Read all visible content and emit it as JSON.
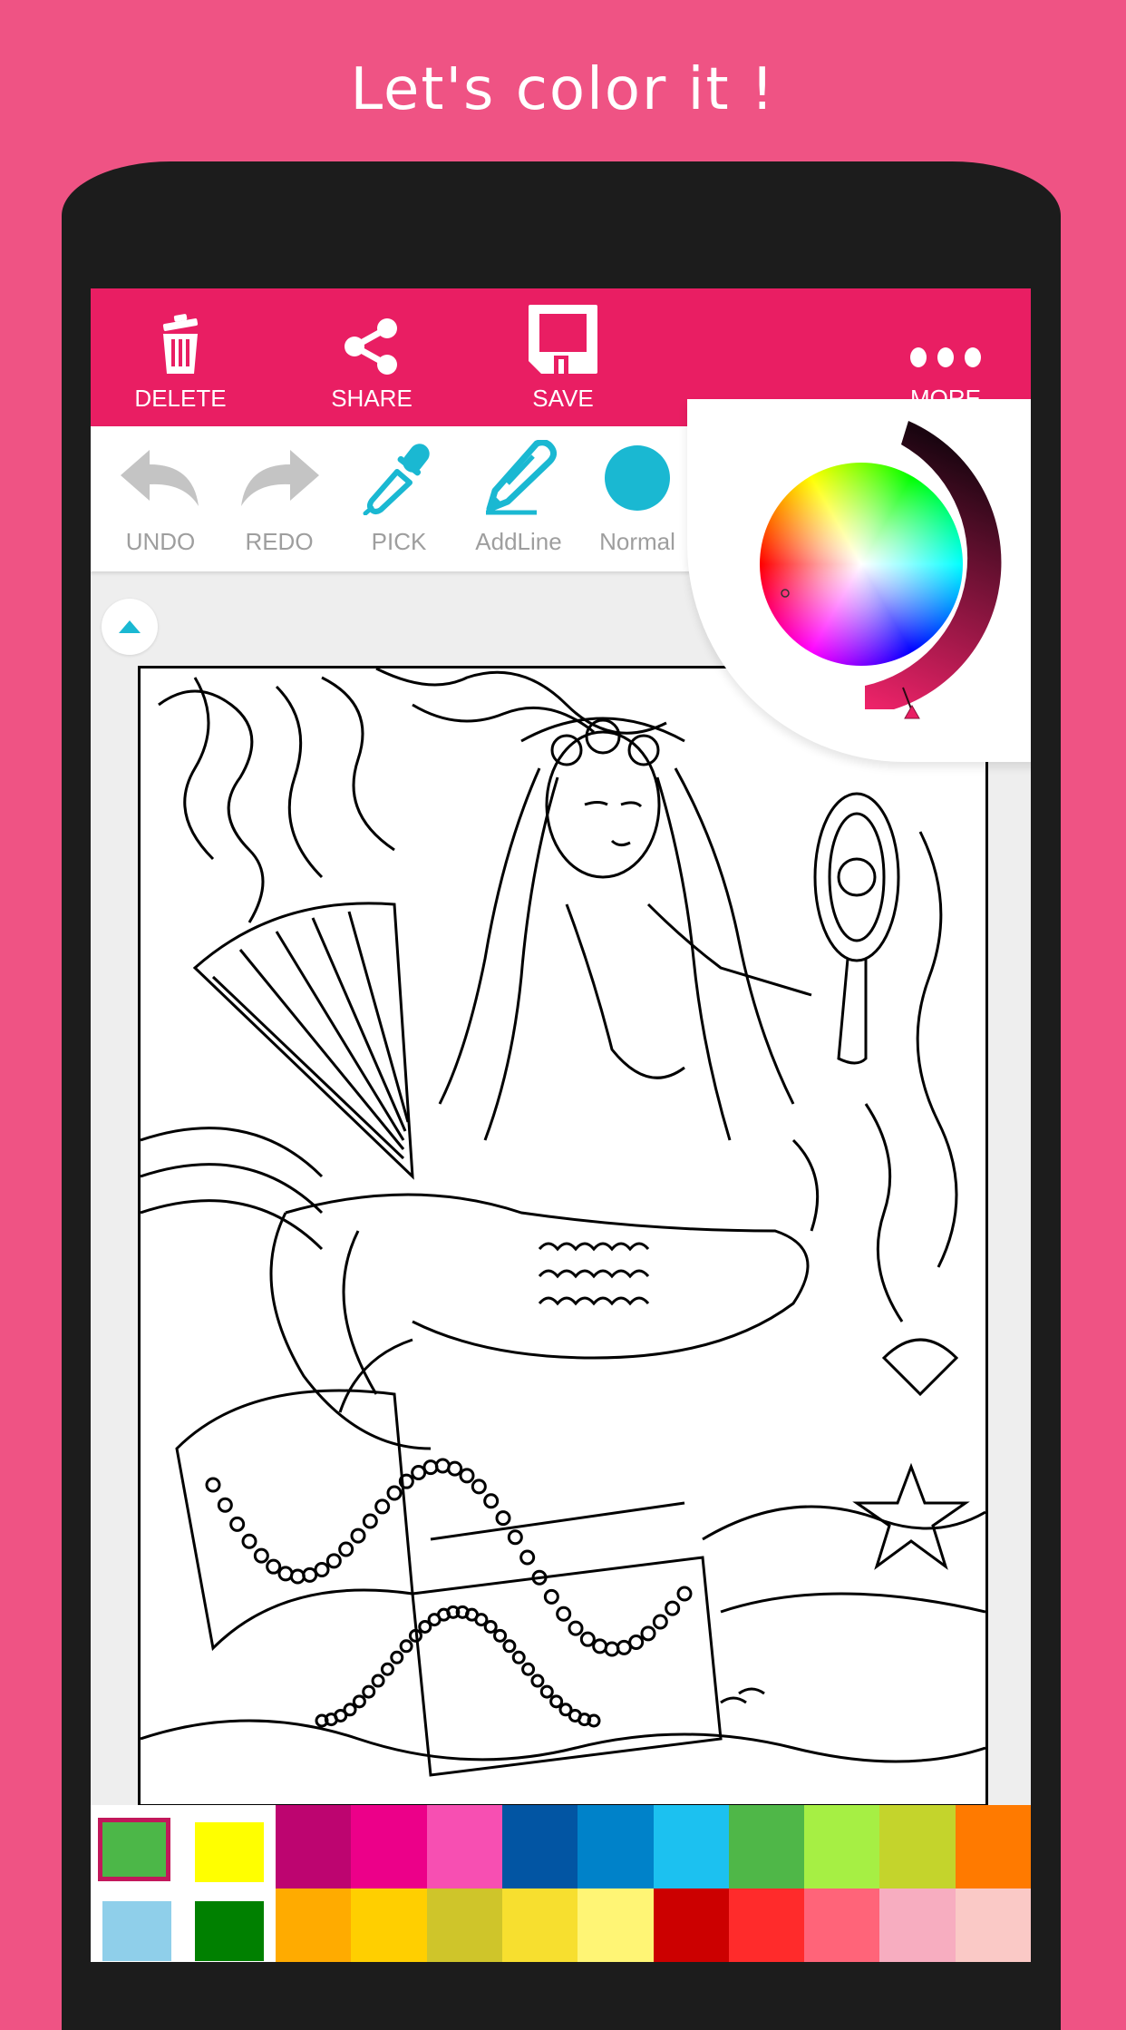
{
  "promo": {
    "title": "Let's color it !"
  },
  "appbar": {
    "background": "#e91e63",
    "actions": [
      {
        "id": "delete",
        "label": "DELETE",
        "icon": "trash-icon"
      },
      {
        "id": "share",
        "label": "SHARE",
        "icon": "share-icon"
      },
      {
        "id": "save",
        "label": "SAVE",
        "icon": "floppy-disk-icon"
      },
      {
        "id": "more",
        "label": "MORE",
        "icon": "more-dots-icon"
      }
    ]
  },
  "toolbar": {
    "accent": "#1ab8d2",
    "disabled": "#c4c4c4",
    "tools": [
      {
        "id": "undo",
        "label": "UNDO",
        "icon": "undo-arrow-icon",
        "enabled": false
      },
      {
        "id": "redo",
        "label": "REDO",
        "icon": "redo-arrow-icon",
        "enabled": false
      },
      {
        "id": "pick",
        "label": "PICK",
        "icon": "eyedropper-icon",
        "enabled": true
      },
      {
        "id": "addline",
        "label": "AddLine",
        "icon": "pencil-line-icon",
        "enabled": true
      },
      {
        "id": "normal",
        "label": "Normal",
        "icon": "brush-circle-icon",
        "enabled": true
      }
    ]
  },
  "canvas": {
    "subject": "mermaid coloring page line art"
  },
  "color_picker": {
    "selected_color": "#e91e63",
    "value_ring_from": "#f0236a",
    "value_ring_to": "#1a0510"
  },
  "palette": {
    "selected_recent": "#4cb748",
    "recent_colors": [
      "#4cb748",
      "#ffff00",
      "#8fcfea",
      "#008000"
    ],
    "row1": [
      "#bd0570",
      "#ec0089",
      "#f74fb2",
      "#0255a3",
      "#0082c9",
      "#1cc1f0",
      "#4fb748",
      "#a6ef44",
      "#c4d42c",
      "#ff7a00"
    ],
    "row2": [
      "#ffab00",
      "#ffcf00",
      "#cfc52a",
      "#f7df2f",
      "#fff575",
      "#cc0000",
      "#ff2b2b",
      "#ff6479",
      "#f7adc0",
      "#fac9c6"
    ]
  }
}
